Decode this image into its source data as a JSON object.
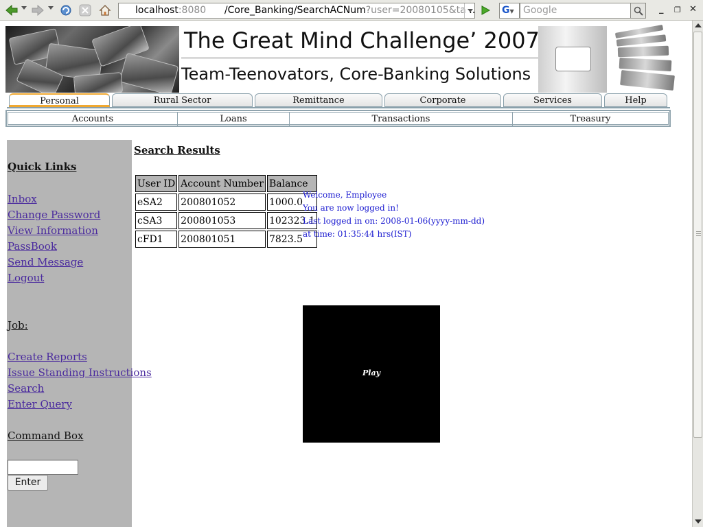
{
  "browser": {
    "url_host": "localhost",
    "url_port": ":8080",
    "url_path": "/Core_Banking/SearchACNum",
    "url_query": "?user=20080105&ta",
    "url_ellipsis": "…",
    "search_engine": "G",
    "search_placeholder": "Google"
  },
  "banner": {
    "title": "The Great Mind Challenge’ 2007",
    "subtitle": "Team-Teenovators, Core-Banking Solutions"
  },
  "tabs": [
    "Personal",
    "Rural Sector",
    "Remittance",
    "Corporate",
    "Services",
    "Help"
  ],
  "subnav": [
    "Accounts",
    "Loans",
    "Transactions",
    "Treasury"
  ],
  "sidebar": {
    "quick_links_heading": "Quick Links",
    "quick_links": [
      "Inbox",
      "Change Password",
      "View Information",
      "PassBook",
      "Send Message",
      "Logout"
    ],
    "job_heading": "Job:",
    "job_links": [
      "Create Reports",
      "Issue Standing Instructions",
      "Search",
      "Enter Query"
    ],
    "command_heading": "Command Box",
    "command_value": "",
    "enter_label": "Enter"
  },
  "main": {
    "results_title": "Search Results",
    "columns": [
      "User ID",
      "Account Number",
      "Balance"
    ],
    "rows": [
      [
        "eSA2",
        "200801052",
        "1000.0"
      ],
      [
        "cSA3",
        "200801053",
        "102323.1"
      ],
      [
        "cFD1",
        "200801051",
        "7823.5"
      ]
    ],
    "welcome": [
      "Welcome, Employee",
      "You are now logged in!",
      "Last logged in on: 2008-01-06(yyyy-mm-dd)",
      "at time: 01:35:44 hrs(IST)"
    ],
    "player_label": "Play"
  },
  "colors": {
    "link": "#4a2a9e",
    "welcome_text": "#1a1ad0",
    "sidebar_bg": "#b5b5b5",
    "active_tab_accent": "#f0a830"
  }
}
